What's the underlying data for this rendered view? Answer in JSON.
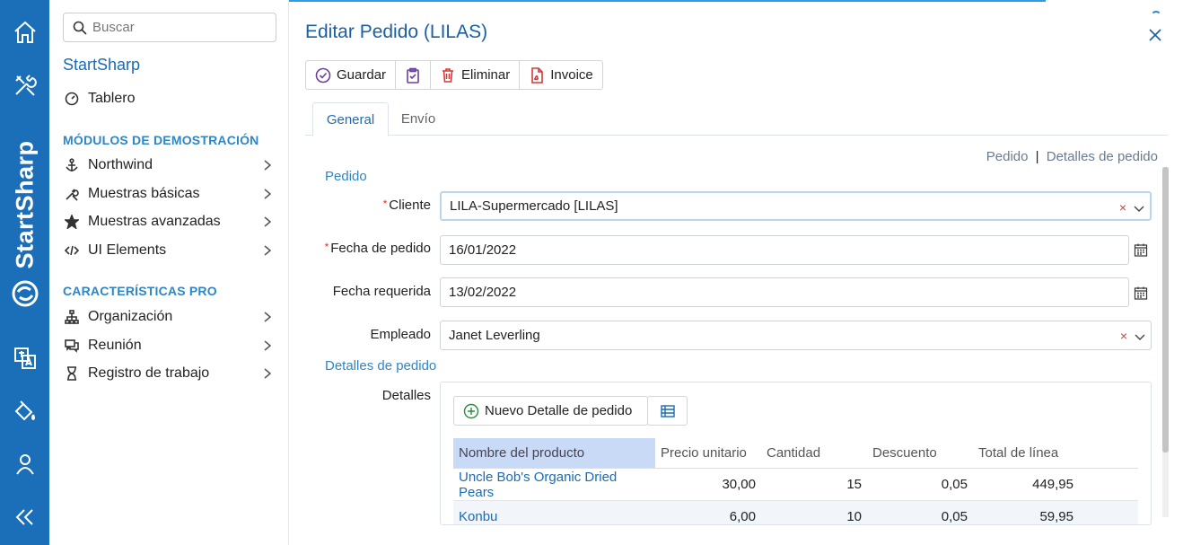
{
  "rail": {
    "brand": "StartSharp",
    "icons": [
      "home-icon",
      "tools-icon",
      "translate-icon",
      "paint-bucket-icon",
      "user-icon",
      "collapse-icon"
    ]
  },
  "sidebar": {
    "search_placeholder": "Buscar",
    "app_title": "StartSharp",
    "dashboard": "Tablero",
    "section_demo": "MÓDULOS DE DEMOSTRACIÓN",
    "demo_items": [
      "Northwind",
      "Muestras básicas",
      "Muestras avanzadas",
      "UI Elements"
    ],
    "section_pro": "CARACTERÍSTICAS PRO",
    "pro_items": [
      "Organización",
      "Reunión",
      "Registro de trabajo"
    ]
  },
  "dialog": {
    "title": "Editar Pedido (LILAS)",
    "toolbar": {
      "save": "Guardar",
      "delete": "Eliminar",
      "invoice": "Invoice"
    },
    "tabs": {
      "general": "General",
      "shipping": "Envío"
    },
    "crumbs": {
      "order": "Pedido",
      "sep": "|",
      "details": "Detalles de pedido"
    },
    "section_order": "Pedido",
    "section_details": "Detalles de pedido",
    "fields": {
      "customer_label": "Cliente",
      "customer_value": "LILA-Supermercado [LILAS]",
      "order_date_label": "Fecha de pedido",
      "order_date_value": "16/01/2022",
      "required_date_label": "Fecha requerida",
      "required_date_value": "13/02/2022",
      "employee_label": "Empleado",
      "employee_value": "Janet Leverling",
      "details_label": "Detalles",
      "required_mark": "*",
      "clear_mark": "×"
    },
    "details": {
      "new_button": "Nuevo Detalle de pedido",
      "columns": [
        "Nombre del producto",
        "Precio unitario",
        "Cantidad",
        "Descuento",
        "Total de línea"
      ],
      "rows": [
        {
          "product": "Uncle Bob's Organic Dried Pears",
          "price": "30,00",
          "qty": "15",
          "discount": "0,05",
          "total": "449,95"
        },
        {
          "product": "Konbu",
          "price": "6,00",
          "qty": "10",
          "discount": "0,05",
          "total": "59,95"
        }
      ]
    }
  },
  "colors": {
    "rail": "#1a6fb8",
    "accent": "#1b6bb6",
    "section": "#2f86c7",
    "required": "#dd3333"
  }
}
